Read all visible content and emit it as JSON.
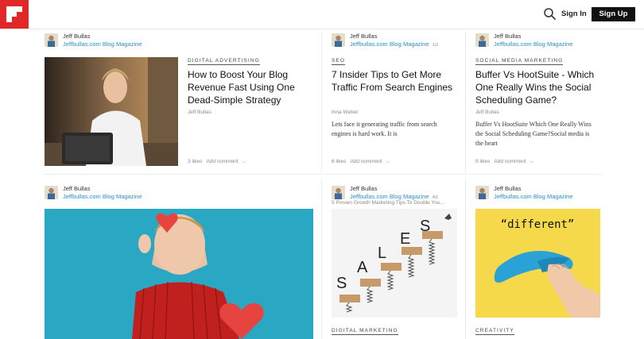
{
  "header": {
    "signin_label": "Sign In",
    "signup_label": "Sign Up"
  },
  "cards": [
    {
      "author": "Jeff Bullas",
      "source": "Jeffbullas.com Blog Magazine",
      "time": "",
      "topic": "DIGITAL ADVERTISING",
      "title": "How to Boost Your Blog Revenue Fast Using One Dead-Simple Strategy",
      "byline": "Jeff Bullas",
      "excerpt": "",
      "likes": "3 likes",
      "add_comment": "Add comment"
    },
    {
      "author": "Jeff Bullas",
      "source": "Jeffbullas.com Blog Magazine",
      "time": "1d",
      "topic": "SEO",
      "title": "7 Insider Tips to Get More Traffic From Search Engines",
      "byline": "Inna Weber",
      "excerpt": "Lets face it generating traffic from search engines is hard work. It is",
      "likes": "6 likes",
      "add_comment": "Add comment"
    },
    {
      "author": "Jeff Bullas",
      "source": "Jeffbullas.com Blog Magazine",
      "time": "",
      "topic": "SOCIAL MEDIA MARKETING",
      "title": "Buffer Vs HootSuite - Which One Really Wins the Social Scheduling Game?",
      "byline": "Jeff Bullas",
      "excerpt": "Buffer Vs HootSuite Which One Really Wins the Social Scheduling Game?Social media is the heart",
      "likes": "9 likes",
      "add_comment": "Add comment"
    },
    {
      "author": "Jeff Bullas",
      "source": "Jeffbullas.com Blog Magazine",
      "time": ""
    },
    {
      "author": "Jeff Bullas",
      "source": "Jeffbullas.com Blog Magazine",
      "time": "4d",
      "subtitle": "5 Proven Growth Marketing Tips To Double You...",
      "image_letters": [
        "S",
        "A",
        "L",
        "E",
        "S"
      ],
      "topic": "DIGITAL MARKETING"
    },
    {
      "author": "Jeff Bullas",
      "source": "Jeffbullas.com Blog Magazine",
      "time": "",
      "image_text": "“different”",
      "topic": "CREATIVITY"
    }
  ],
  "colors": {
    "brand_red": "#e12828",
    "link_blue": "#2a8fc6",
    "teal_bg": "#2aa8c3",
    "yellow_bg": "#f5d94a"
  }
}
